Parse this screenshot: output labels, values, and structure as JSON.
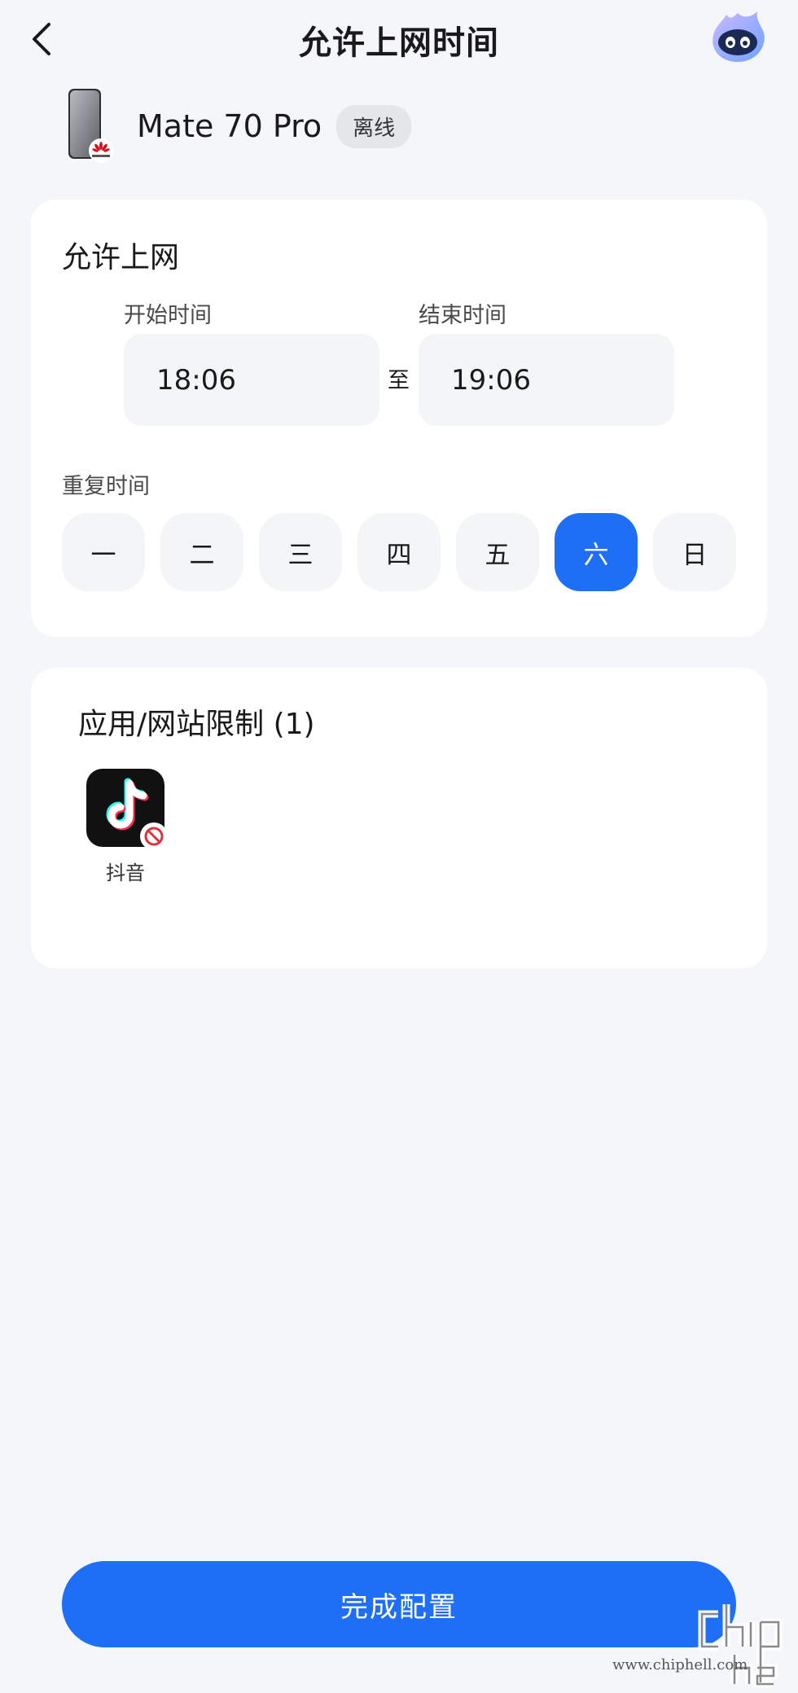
{
  "header": {
    "title": "允许上网时间"
  },
  "device": {
    "name": "Mate 70 Pro",
    "status": "离线"
  },
  "schedule": {
    "section_title": "允许上网",
    "start_label": "开始时间",
    "start_time": "18:06",
    "to_label": "至",
    "end_label": "结束时间",
    "end_time": "19:06",
    "repeat_label": "重复时间",
    "days": [
      {
        "label": "一",
        "selected": false
      },
      {
        "label": "二",
        "selected": false
      },
      {
        "label": "三",
        "selected": false
      },
      {
        "label": "四",
        "selected": false
      },
      {
        "label": "五",
        "selected": false
      },
      {
        "label": "六",
        "selected": true
      },
      {
        "label": "日",
        "selected": false
      }
    ]
  },
  "apps": {
    "section_title": "应用/网站限制 (1)",
    "items": [
      {
        "name": "抖音",
        "icon": "douyin-icon",
        "blocked": true
      }
    ]
  },
  "footer": {
    "done_label": "完成配置"
  },
  "watermark": {
    "text": "www.chiphell.com"
  },
  "colors": {
    "accent": "#1e6ff5",
    "background": "#f4f6fa",
    "card": "#ffffff",
    "block": "#e0323c"
  }
}
